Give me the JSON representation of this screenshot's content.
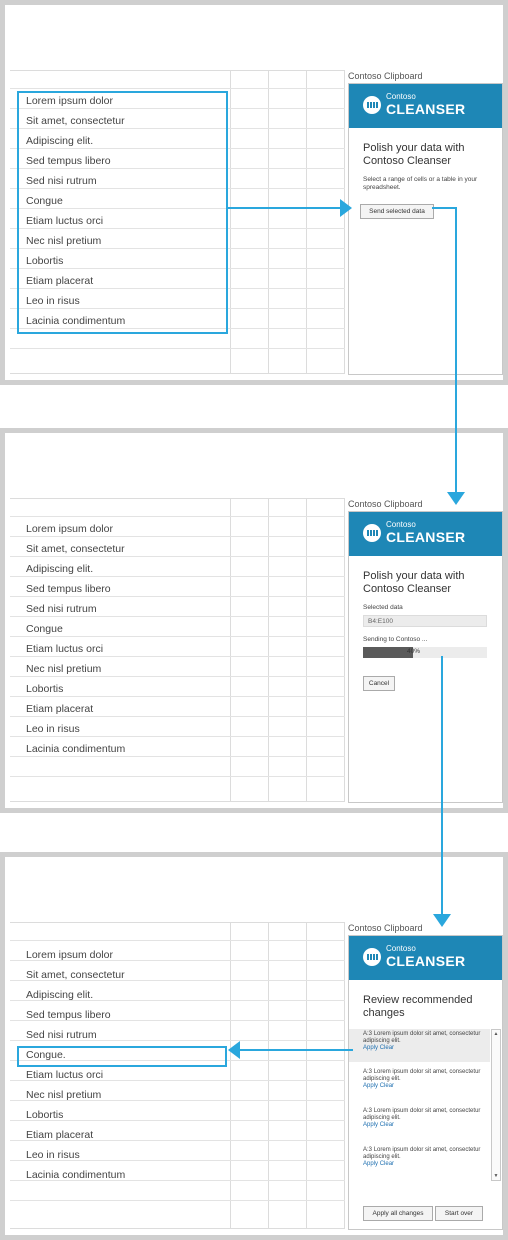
{
  "cells": [
    "Lorem ipsum dolor",
    "Sit amet, consectetur",
    "Adipiscing elit.",
    "Sed tempus libero",
    "Sed nisi rutrum",
    "Congue",
    "Etiam luctus orci",
    "Nec nisl pretium",
    "Lobortis",
    "Etiam placerat",
    "Leo in risus",
    "Lacinia condimentum"
  ],
  "cell_congue_edited": "Congue.",
  "pane_title": "Contoso Clipboard",
  "brand": {
    "small": "Contoso",
    "big": "CLEANSER"
  },
  "step1": {
    "heading": "Polish your data with Contoso Cleanser",
    "instruction": "Select a range of cells or a table in your spreadsheet.",
    "send_button": "Send selected data"
  },
  "step2": {
    "heading": "Polish your data with Contoso Cleanser",
    "selected_label": "Selected data",
    "selected_value": "B4:E100",
    "sending_label": "Sending to Contoso ...",
    "progress_percent": 40,
    "progress_text": "40%",
    "cancel_button": "Cancel"
  },
  "step3": {
    "heading": "Review recommended changes",
    "recommendations": [
      {
        "ref": "A:3",
        "text": "Lorem ipsum dolor sit amet, consectetur adipiscing elit.",
        "apply": "Apply",
        "clear": "Clear"
      },
      {
        "ref": "A:3",
        "text": "Lorem ipsum dolor sit amet, consectetur adipiscing elit.",
        "apply": "Apply",
        "clear": "Clear"
      },
      {
        "ref": "A:3",
        "text": "Lorem ipsum dolor sit amet, consectetur adipiscing elit.",
        "apply": "Apply",
        "clear": "Clear"
      },
      {
        "ref": "A:3",
        "text": "Lorem ipsum dolor sit amet, consectetur adipiscing elit.",
        "apply": "Apply",
        "clear": "Clear"
      }
    ],
    "apply_all_button": "Apply all changes",
    "start_over_button": "Start over"
  },
  "colors": {
    "accent": "#1e87b6",
    "highlight": "#2aa7dd",
    "frame": "#cfcfcf"
  }
}
